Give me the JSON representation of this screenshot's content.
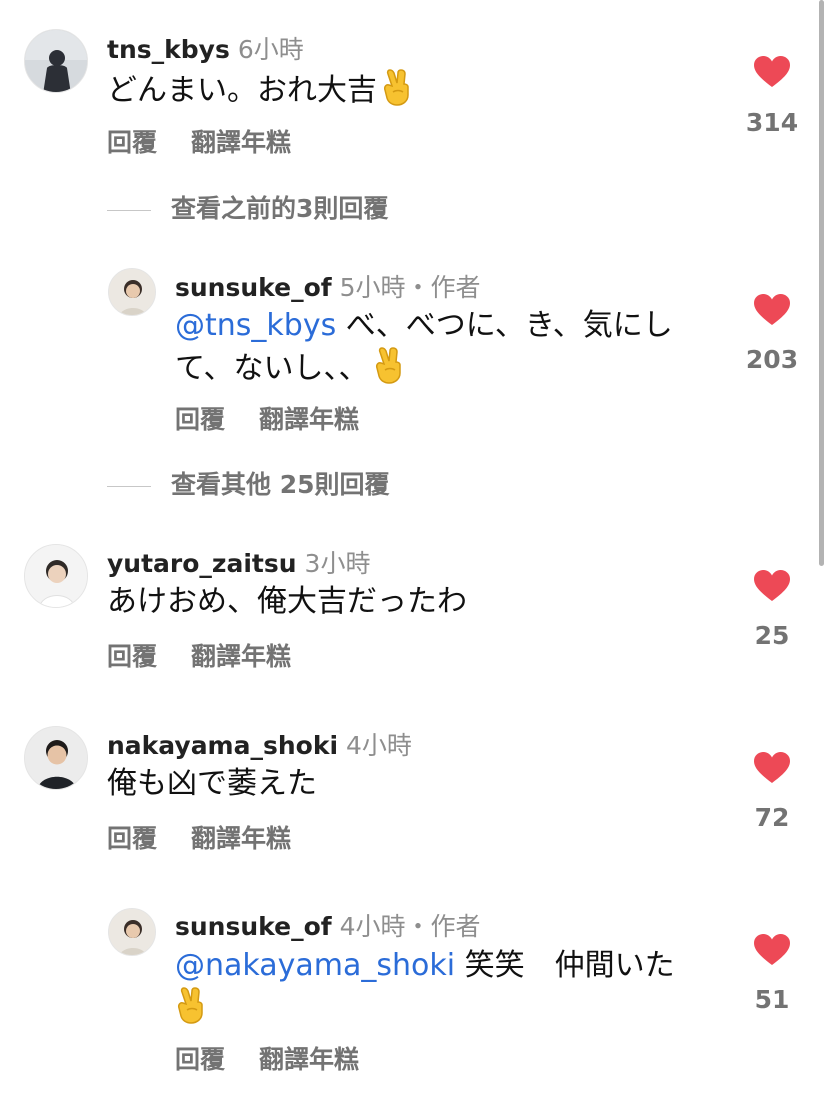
{
  "comments": [
    {
      "username": "tns_kbys",
      "time": "6小時",
      "text": "どんまい。おれ大吉",
      "likes": "314"
    },
    {
      "username": "sunsuke_of",
      "time": "5小時",
      "author_tag": "・作者",
      "mention": "@tns_kbys",
      "text_line1": " べ、べつに、き、気にし",
      "text_line2": "て、ないし、、",
      "likes": "203"
    },
    {
      "username": "yutaro_zaitsu",
      "time": "3小時",
      "text": "あけおめ、俺大吉だったわ",
      "likes": "25"
    },
    {
      "username": "nakayama_shoki",
      "time": "4小時",
      "text": "俺も凶で萎えた",
      "likes": "72"
    },
    {
      "username": "sunsuke_of",
      "time": "4小時",
      "author_tag": "・作者",
      "mention": "@nakayama_shoki",
      "text_line1": " 笑笑　仲間いた",
      "likes": "51"
    }
  ],
  "actions": {
    "reply": "回覆",
    "translate": "翻譯年糕"
  },
  "view_more": {
    "previous": "查看之前的3則回覆",
    "others": "查看其他 25則回覆"
  },
  "colors": {
    "heart": "#ed4956",
    "mention": "#2b6cd8",
    "secondary_text": "#737373"
  },
  "icons": [
    "heart-icon",
    "victory-hand-emoji"
  ]
}
